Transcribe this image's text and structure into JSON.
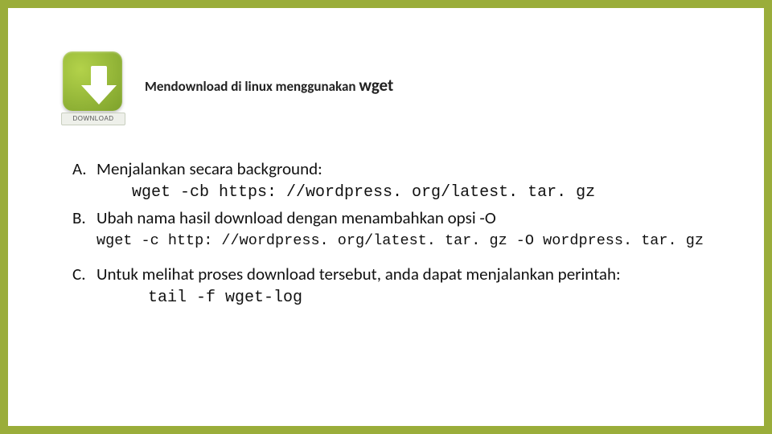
{
  "icon": {
    "label": "DOWNLOAD"
  },
  "title": {
    "prefix": "Mendownload di linux menggunakan ",
    "cmd": "wget"
  },
  "items": [
    {
      "marker": "A.",
      "text": "Menjalankan secara background:",
      "code": "wget -cb https: //wordpress. org/latest. tar. gz",
      "code_indent": "indent1"
    },
    {
      "marker": "B.",
      "text": "Ubah nama hasil download dengan menambahkan opsi -O",
      "code": "wget -c http: //wordpress. org/latest. tar. gz -O wordpress. tar. gz",
      "code_indent": "",
      "code_small": true
    },
    {
      "marker": "C.",
      "text": "Untuk melihat proses download tersebut, anda dapat menjalankan perintah:",
      "code": "tail -f wget-log",
      "code_indent": "indent2",
      "spacer_before": true
    }
  ]
}
